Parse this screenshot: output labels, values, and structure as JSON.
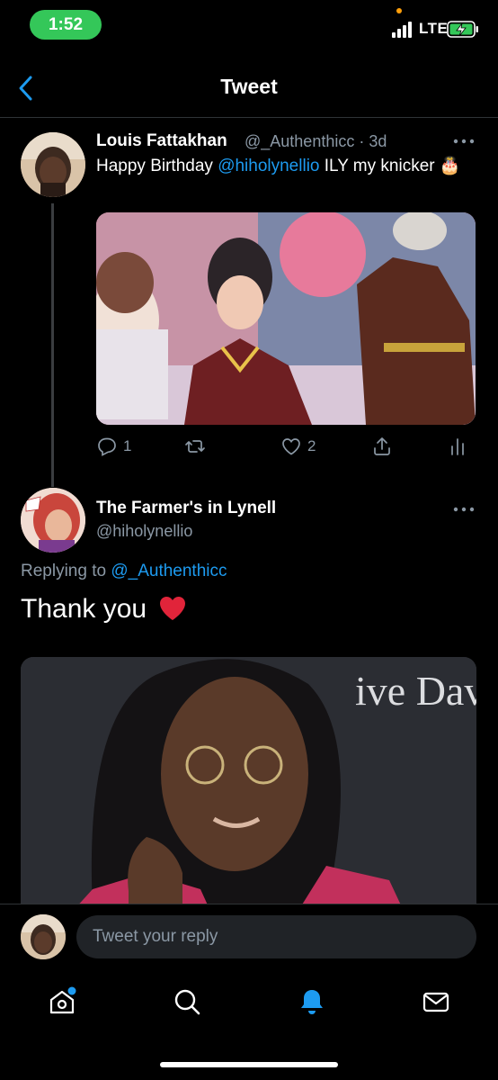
{
  "status_bar": {
    "time": "1:52",
    "network": "LTE",
    "accent_time_bg": "#34c759"
  },
  "header": {
    "title": "Tweet",
    "back_icon": "chevron-left-icon"
  },
  "tweet": {
    "author_name": "Louis Fattakhan",
    "author_handle": "@_Authenthicc",
    "age": "· 3d",
    "text_prefix": "Happy Birthday ",
    "text_mention": "@hiholynellio",
    "text_suffix": " ILY my knicker 🎂",
    "media_icon": "birthday-collage-image",
    "actions": {
      "reply_count": "1",
      "retweet_count": "",
      "like_count": "2"
    }
  },
  "reply": {
    "author_name": "The Farmer's in Lynell",
    "author_handle": "@hiholynellio",
    "replying_label": "Replying to ",
    "replying_to": "@_Authenthicc",
    "text": "Thank you",
    "media_caption": "ive Davis"
  },
  "composer": {
    "placeholder": "Tweet your reply"
  },
  "tab_bar": {
    "items": [
      "home-icon",
      "search-icon",
      "notifications-icon",
      "messages-icon"
    ],
    "active": "notifications-icon"
  },
  "colors": {
    "accent": "#1d9bf0",
    "muted": "#8b98a5",
    "background": "#000000"
  }
}
